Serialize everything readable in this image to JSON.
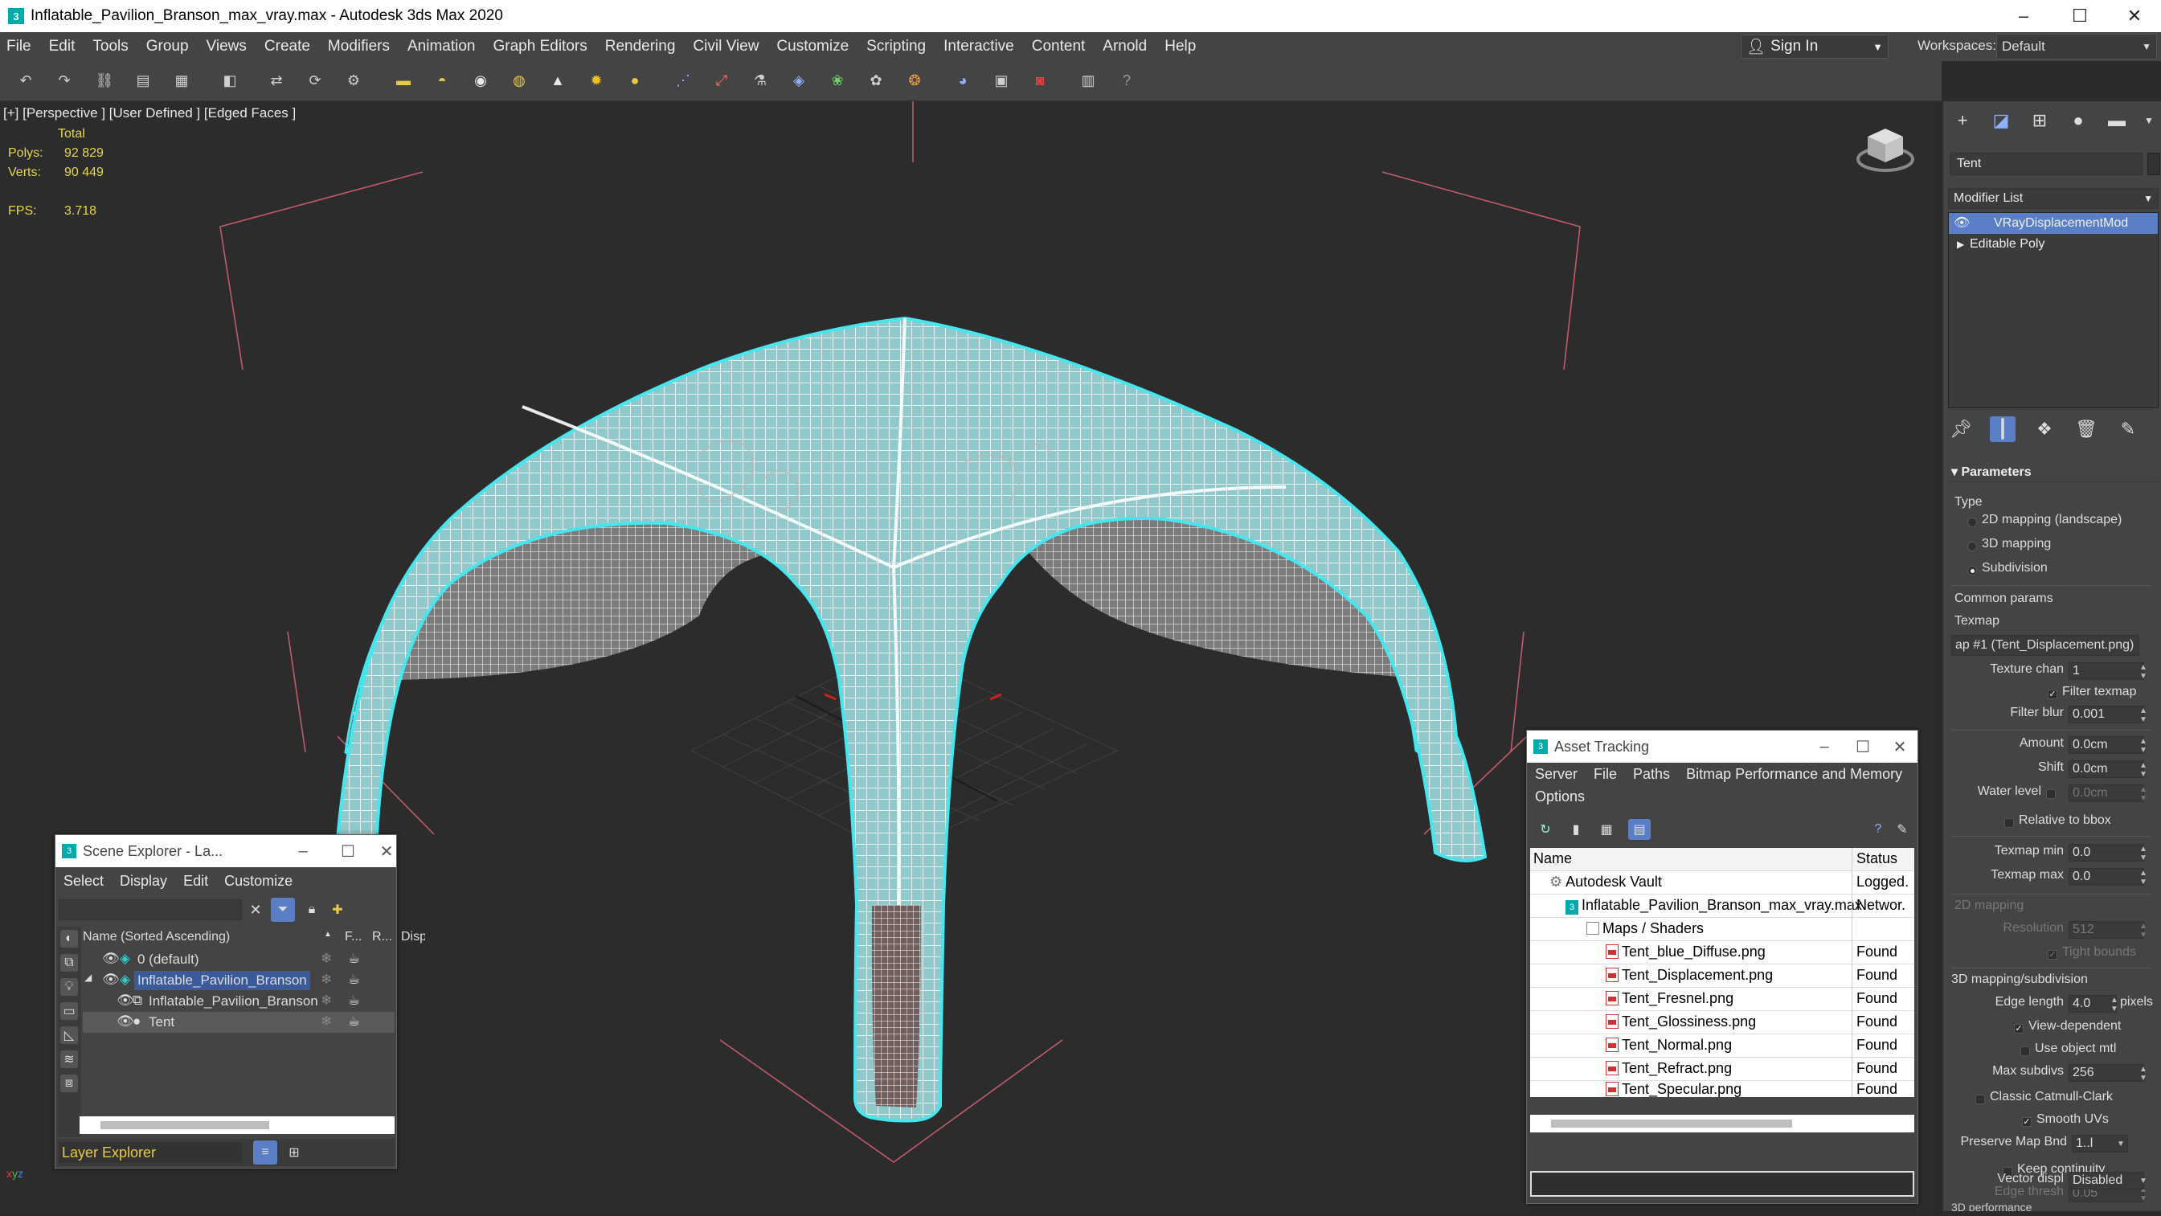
{
  "window": {
    "title": "Inflatable_Pavilion_Branson_max_vray.max - Autodesk 3ds Max 2020"
  },
  "menu": [
    "File",
    "Edit",
    "Tools",
    "Group",
    "Views",
    "Create",
    "Modifiers",
    "Animation",
    "Graph Editors",
    "Rendering",
    "Civil View",
    "Customize",
    "Scripting",
    "Interactive",
    "Content",
    "Arnold",
    "Help"
  ],
  "account": {
    "signin": "Sign In",
    "workspaces_label": "Workspaces:",
    "workspace": "Default"
  },
  "viewport": {
    "label": "[+] [Perspective ] [User Defined ] [Edged Faces ]",
    "stats_header": "Total",
    "polys_label": "Polys:",
    "polys": "92 829",
    "verts_label": "Verts:",
    "verts": "90 449",
    "fps_label": "FPS:",
    "fps": "3.718",
    "colors": {
      "wire": "#ffffff",
      "selection": "#46e6ee",
      "mesh": "#8fc9cc",
      "inner": "#8a8a8a"
    }
  },
  "command_panel": {
    "object_name": "Tent",
    "modifier_list": "Modifier List",
    "stack": [
      "VRayDisplacementMod",
      "Editable Poly"
    ],
    "rollout": "Parameters",
    "type_label": "Type",
    "type_options": [
      "2D mapping (landscape)",
      "3D mapping",
      "Subdivision"
    ],
    "type_selected": "Subdivision",
    "common_params": "Common params",
    "texmap_label": "Texmap",
    "texmap_value": "ap #1 (Tent_Displacement.png)",
    "texture_chan_label": "Texture chan",
    "texture_chan": "1",
    "filter_texmap": "Filter texmap",
    "filter_blur_label": "Filter blur",
    "filter_blur": "0.001",
    "amount_label": "Amount",
    "amount": "0.0cm",
    "shift_label": "Shift",
    "shift": "0.0cm",
    "water_level_label": "Water level",
    "water_level": "0.0cm",
    "relative_to_bbox": "Relative to bbox",
    "texmap_min_label": "Texmap min",
    "texmap_min": "0.0",
    "texmap_max_label": "Texmap max",
    "texmap_max": "0.0",
    "mapping2d": "2D mapping",
    "resolution_label": "Resolution",
    "resolution": "512",
    "tight_bounds": "Tight bounds",
    "mapping3d": "3D mapping/subdivision",
    "edge_length_label": "Edge length",
    "edge_length": "4.0",
    "pixels": "pixels",
    "view_dependent": "View-dependent",
    "use_object_mtl": "Use object mtl",
    "max_subdivs_label": "Max subdivs",
    "max_subdivs": "256",
    "classic_catmull": "Classic Catmull-Clark",
    "smooth_uvs": "Smooth UVs",
    "preserve_map_label": "Preserve Map Bnd",
    "preserve_map": "1..l",
    "keep_continuity": "Keep continuity",
    "edge_thresh_label": "Edge thresh",
    "edge_thresh": "0.05",
    "vector_displ_label": "Vector displ",
    "vector_displ": "Disabled",
    "last_label": "3D performance"
  },
  "scene_explorer": {
    "title": "Scene Explorer - La...",
    "menu": [
      "Select",
      "Display",
      "Edit",
      "Customize"
    ],
    "col_name": "Name (Sorted Ascending)",
    "col_f": "F...",
    "col_r": "R...",
    "col_d": "Disp",
    "rows": [
      "0 (default)",
      "Inflatable_Pavilion_Branson",
      "Inflatable_Pavilion_Branson",
      "Tent"
    ],
    "footer": "Layer Explorer"
  },
  "asset_tracking": {
    "title": "Asset Tracking",
    "menu": [
      "Server",
      "File",
      "Paths",
      "Bitmap Performance and Memory"
    ],
    "menu2": "Options",
    "col_name": "Name",
    "col_status": "Status",
    "rows": [
      {
        "name": "Autodesk Vault",
        "status": "Logged."
      },
      {
        "name": "Inflatable_Pavilion_Branson_max_vray.max",
        "status": "Networ."
      },
      {
        "name": "Maps / Shaders",
        "status": ""
      },
      {
        "name": "Tent_blue_Diffuse.png",
        "status": "Found"
      },
      {
        "name": "Tent_Displacement.png",
        "status": "Found"
      },
      {
        "name": "Tent_Fresnel.png",
        "status": "Found"
      },
      {
        "name": "Tent_Glossiness.png",
        "status": "Found"
      },
      {
        "name": "Tent_Normal.png",
        "status": "Found"
      },
      {
        "name": "Tent_Refract.png",
        "status": "Found"
      },
      {
        "name": "Tent_Specular.png",
        "status": "Found"
      }
    ]
  }
}
